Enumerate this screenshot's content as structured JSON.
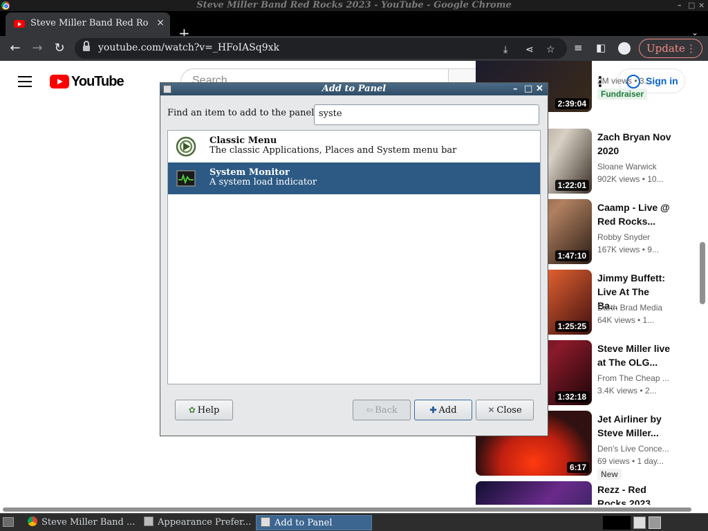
{
  "window": {
    "title": "Steve Miller Band Red Rocks 2023 - YouTube - Google Chrome",
    "controls": [
      "–",
      "□",
      "×"
    ]
  },
  "tab": {
    "title": "Steve Miller Band Red Rocks 2023 - YouTube",
    "close": "×",
    "new_tab": "+",
    "tab_menu": "⌄"
  },
  "toolbar": {
    "url": "youtube.com/watch?v=_HFoIASq9xk",
    "update_label": "Update",
    "update_menu": "⋮"
  },
  "youtube": {
    "logo_text": "YouTube",
    "search_placeholder": "Search",
    "menu_dots": "⋮",
    "sign_in": "Sign in"
  },
  "recommendations": [
    {
      "title": "",
      "channel": "",
      "meta": "2M views • 3...",
      "duration": "2:39:04",
      "badge": "Fundraiser"
    },
    {
      "title": "Zach Bryan Nov 2020",
      "channel": "Sloane Warwick",
      "meta": "902K views • 10...",
      "duration": "1:22:01",
      "badge": ""
    },
    {
      "title": "Caamp - Live @ Red Rocks...",
      "channel": "Robby Snyder",
      "meta": "167K views • 9...",
      "duration": "1:47:10",
      "badge": ""
    },
    {
      "title": "Jimmy Buffett: Live At The Ba...",
      "channel": "Darth Brad Media",
      "meta": "64K views • 1...",
      "duration": "1:25:25",
      "badge": ""
    },
    {
      "title": "Steve Miller live at The OLG...",
      "channel": "From The Cheap ...",
      "meta": "3.4K views • 2...",
      "duration": "1:32:18",
      "badge": ""
    },
    {
      "title": "Jet Airliner by Steve Miller...",
      "channel": "Den's Live Conce...",
      "meta": "69 views • 1 day...",
      "duration": "6:17",
      "badge": "New"
    },
    {
      "title": "Rezz - Red Rocks 2023",
      "channel": "",
      "meta": "",
      "duration": "",
      "badge": ""
    }
  ],
  "dialog": {
    "title": "Add to Panel",
    "find_label": "Find an item to add to the panel:",
    "search_value": "syste",
    "items": [
      {
        "name": "Classic Menu",
        "description": "The classic Applications, Places and System menu bar",
        "icon": "classic-menu-icon",
        "selected": false
      },
      {
        "name": "System Monitor",
        "description": "A system load indicator",
        "icon": "system-monitor-icon",
        "selected": true
      }
    ],
    "buttons": {
      "help": "Help",
      "back": "Back",
      "add": "Add",
      "close": "Close"
    }
  },
  "taskbar": {
    "tasks": [
      {
        "label": "Steve Miller Band ...",
        "icon": "chrome-icon",
        "active": false
      },
      {
        "label": "Appearance Prefer...",
        "icon": "appearance-icon",
        "active": false
      },
      {
        "label": "Add to Panel",
        "icon": "panel-icon",
        "active": true
      }
    ]
  },
  "colors": {
    "selection": "#2c5a84",
    "youtube_red": "#ff0000",
    "sign_in_blue": "#065fd4",
    "update_red": "#f28b82"
  }
}
